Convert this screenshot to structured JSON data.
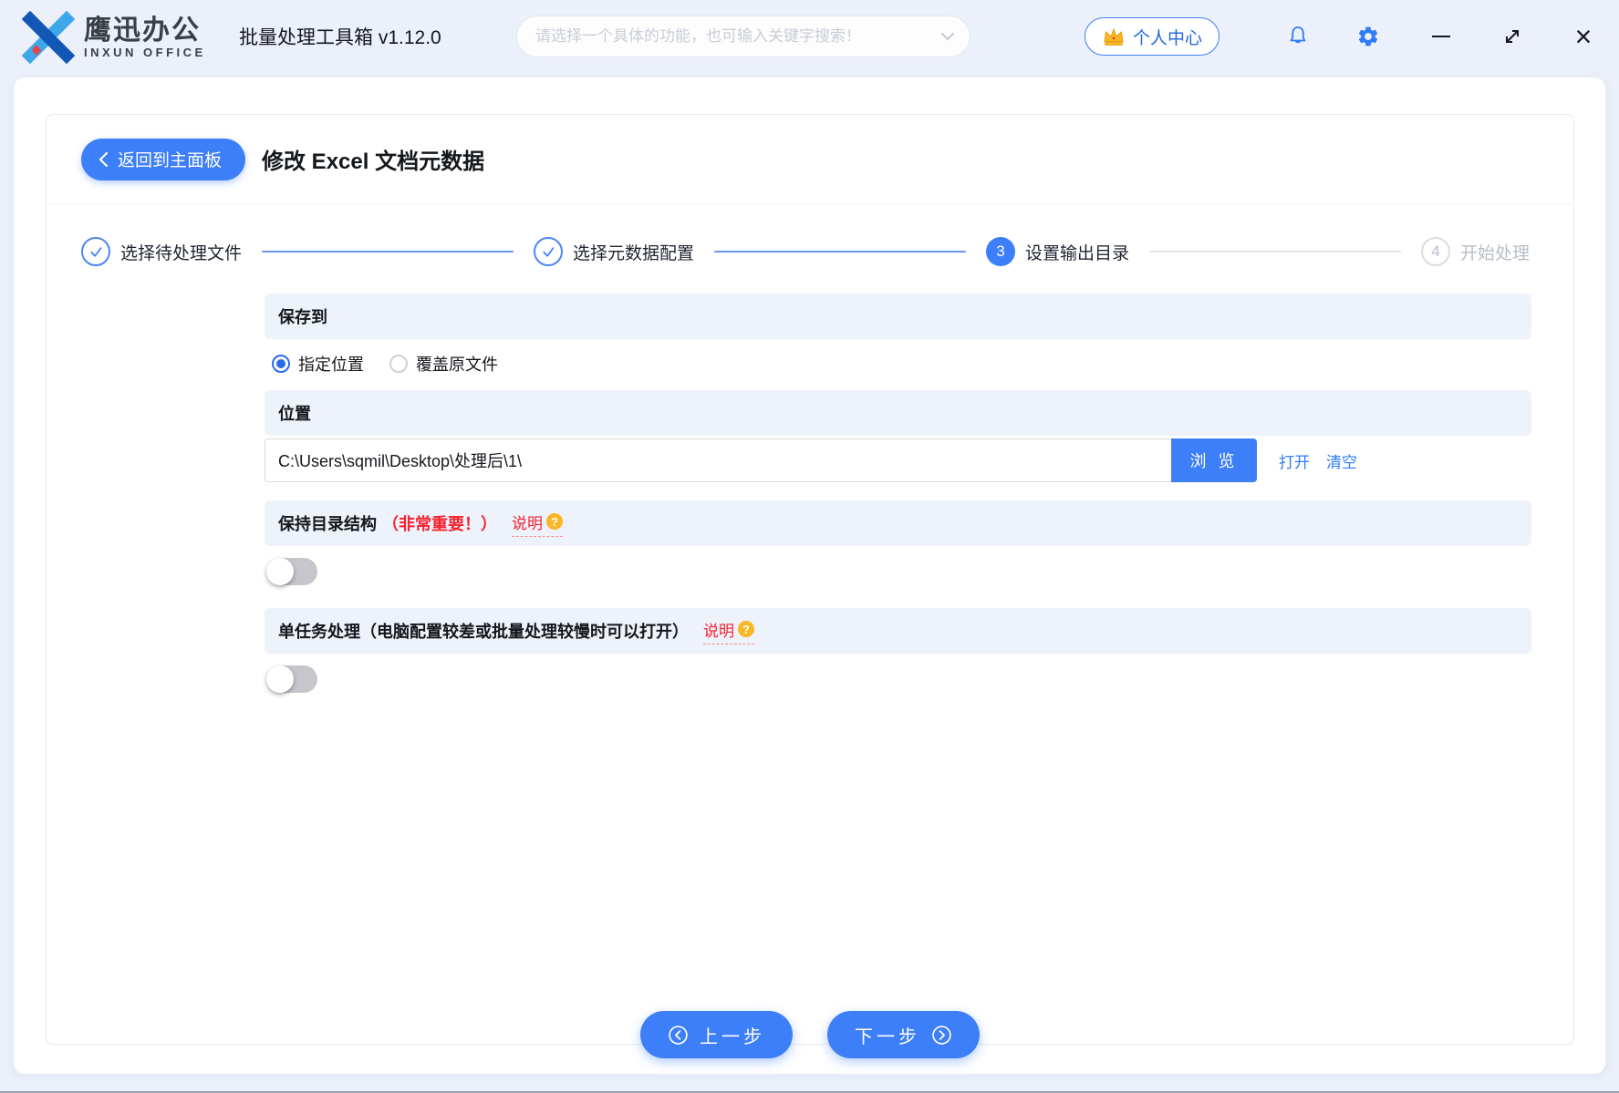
{
  "header": {
    "logo_cn": "鹰迅办公",
    "logo_en": "INXUN OFFICE",
    "app_title": "批量处理工具箱 v1.12.0",
    "search_placeholder": "请选择一个具体的功能，也可输入关键字搜索！",
    "user_center_label": "个人中心"
  },
  "window_controls": {
    "close_glyph": "×"
  },
  "page": {
    "back_label": "返回到主面板",
    "title": "修改 Excel 文档元数据"
  },
  "steps": [
    {
      "label": "选择待处理文件",
      "state": "done"
    },
    {
      "label": "选择元数据配置",
      "state": "done"
    },
    {
      "label": "设置输出目录",
      "state": "active",
      "number": "3"
    },
    {
      "label": "开始处理",
      "state": "pending",
      "number": "4"
    }
  ],
  "form": {
    "save_to": {
      "title": "保存到",
      "option_specified": "指定位置",
      "option_overwrite": "覆盖原文件",
      "selected": "指定位置"
    },
    "location": {
      "title": "位置",
      "path": "C:\\Users\\sqmil\\Desktop\\处理后\\1\\",
      "browse_label": "浏 览",
      "open_label": "打开",
      "clear_label": "清空"
    },
    "keep_structure": {
      "title": "保持目录结构",
      "important": "（非常重要！）",
      "help_label": "说明",
      "help_mark": "?",
      "enabled": false
    },
    "single_task": {
      "title": "单任务处理（电脑配置较差或批量处理较慢时可以打开）",
      "help_label": "说明",
      "help_mark": "?",
      "enabled": false
    }
  },
  "footer": {
    "prev_label": "上一步",
    "next_label": "下一步"
  },
  "colors": {
    "accent": "#3d7ef9",
    "danger": "#f5222d",
    "warning": "#f9b626",
    "link": "#2f7cf6"
  }
}
